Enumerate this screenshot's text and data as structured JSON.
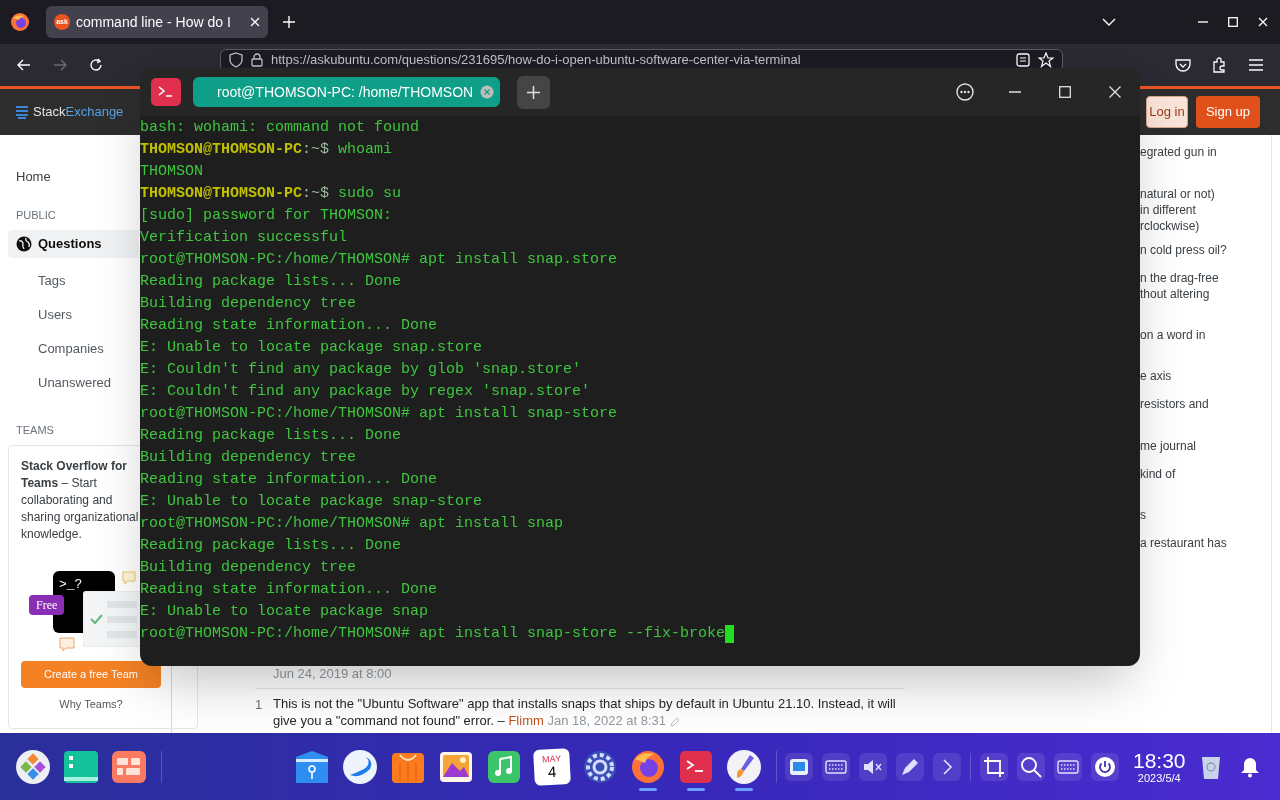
{
  "browser": {
    "tab": {
      "favicon_text": "ask",
      "title": "command line - How do I",
      "selected": true
    },
    "url": "https://askubuntu.com/questions/231695/how-do-i-open-ubuntu-software-center-via-terminal"
  },
  "site_header": {
    "logo_parts": [
      "Stack",
      "Exchange"
    ],
    "login": "Log in",
    "signup": "Sign up"
  },
  "sidebar": {
    "home": "Home",
    "sections": [
      {
        "heading": "PUBLIC",
        "items": [
          {
            "label": "Questions",
            "selected": true
          },
          {
            "label": "Tags",
            "selected": false
          },
          {
            "label": "Users",
            "selected": false
          },
          {
            "label": "Companies",
            "selected": false
          },
          {
            "label": "Unanswered",
            "selected": false
          }
        ]
      },
      {
        "heading": "TEAMS"
      }
    ]
  },
  "teams_promo": {
    "text": "**Stack Overflow for Teams** – Start collaborating and sharing organizational knowledge.",
    "illustration_text": ">_?",
    "badge": "Free",
    "button": "Create a free Team",
    "link": "Why Teams?"
  },
  "hot_questions": [
    [
      "egrated gun in"
    ],
    [
      "natural or not)",
      "in different",
      "rclockwise)"
    ],
    [
      "n cold press oil?"
    ],
    [
      "n the drag-free",
      "thout altering"
    ],
    [
      "on a word in"
    ],
    [
      "e axis"
    ],
    [
      "resistors and"
    ],
    [
      "me journal"
    ],
    [
      "kind of"
    ],
    [
      "s"
    ],
    [
      "a restaurant has"
    ]
  ],
  "comments": {
    "date": "Jun 24, 2019 at 8:00",
    "score": "1",
    "text": "This is not the \"Ubuntu Software\" app that installs snaps that ships by default in Ubuntu 21.10. Instead, it will give you a \"command not found\" error. –",
    "author": "Flimm",
    "time": "Jan 18, 2022 at 8:31"
  },
  "terminal": {
    "tab_title": "root@THOMSON-PC: /home/THOMSON",
    "lines": [
      {
        "kind": "output",
        "text": "bash: wohami: command not found"
      },
      {
        "kind": "user_prompt",
        "prompt": "THOMSON@THOMSON-PC",
        "path": ":~$",
        "command": "whoami",
        "cursor": false
      },
      {
        "kind": "output",
        "text": "THOMSON"
      },
      {
        "kind": "user_prompt",
        "prompt": "THOMSON@THOMSON-PC",
        "path": ":~$",
        "command": "sudo su",
        "cursor": false
      },
      {
        "kind": "output",
        "text": "[sudo] password for THOMSON:"
      },
      {
        "kind": "output",
        "text": "Verification successful"
      },
      {
        "kind": "root_prompt",
        "prompt": "root@THOMSON-PC:/home/THOMSON#",
        "command": "apt install snap.store",
        "cursor": false
      },
      {
        "kind": "output",
        "text": "Reading package lists... Done"
      },
      {
        "kind": "output",
        "text": "Building dependency tree"
      },
      {
        "kind": "output",
        "text": "Reading state information... Done"
      },
      {
        "kind": "output",
        "text": "E: Unable to locate package snap.store"
      },
      {
        "kind": "output",
        "text": "E: Couldn't find any package by glob 'snap.store'"
      },
      {
        "kind": "output",
        "text": "E: Couldn't find any package by regex 'snap.store'"
      },
      {
        "kind": "root_prompt",
        "prompt": "root@THOMSON-PC:/home/THOMSON#",
        "command": "apt install snap-store",
        "cursor": false
      },
      {
        "kind": "output",
        "text": "Reading package lists... Done"
      },
      {
        "kind": "output",
        "text": "Building dependency tree"
      },
      {
        "kind": "output",
        "text": "Reading state information... Done"
      },
      {
        "kind": "output",
        "text": "E: Unable to locate package snap-store"
      },
      {
        "kind": "root_prompt",
        "prompt": "root@THOMSON-PC:/home/THOMSON#",
        "command": "apt install snap",
        "cursor": false
      },
      {
        "kind": "output",
        "text": "Reading package lists... Done"
      },
      {
        "kind": "output",
        "text": "Building dependency tree"
      },
      {
        "kind": "output",
        "text": "Reading state information... Done"
      },
      {
        "kind": "output",
        "text": "E: Unable to locate package snap"
      },
      {
        "kind": "root_prompt",
        "prompt": "root@THOMSON-PC:/home/THOMSON#",
        "command": "apt install snap-store --fix-broke",
        "cursor": true
      }
    ]
  },
  "taskbar": {
    "launchers": [
      {
        "kind": "launcher"
      },
      {
        "kind": "files"
      },
      {
        "kind": "multitask"
      }
    ],
    "dock": [
      {
        "kind": "folder",
        "running": false
      },
      {
        "kind": "swirl",
        "running": false
      },
      {
        "kind": "store",
        "running": false
      },
      {
        "kind": "photos",
        "running": false
      },
      {
        "kind": "music",
        "running": false
      },
      {
        "kind": "calendar",
        "running": false,
        "month": "MAY",
        "day": "4"
      },
      {
        "kind": "settings",
        "running": false
      },
      {
        "kind": "firefox",
        "running": true
      },
      {
        "kind": "terminal",
        "running": true
      },
      {
        "kind": "paint",
        "running": true
      }
    ],
    "tray": [
      {
        "kind": "screen"
      },
      {
        "kind": "keyboard"
      },
      {
        "kind": "mute"
      },
      {
        "kind": "pen"
      },
      {
        "kind": "chevron"
      },
      {
        "kind": "crop"
      },
      {
        "kind": "search"
      },
      {
        "kind": "keyboard"
      },
      {
        "kind": "power"
      }
    ],
    "time": "18:30",
    "date": "2023/5/4"
  }
}
